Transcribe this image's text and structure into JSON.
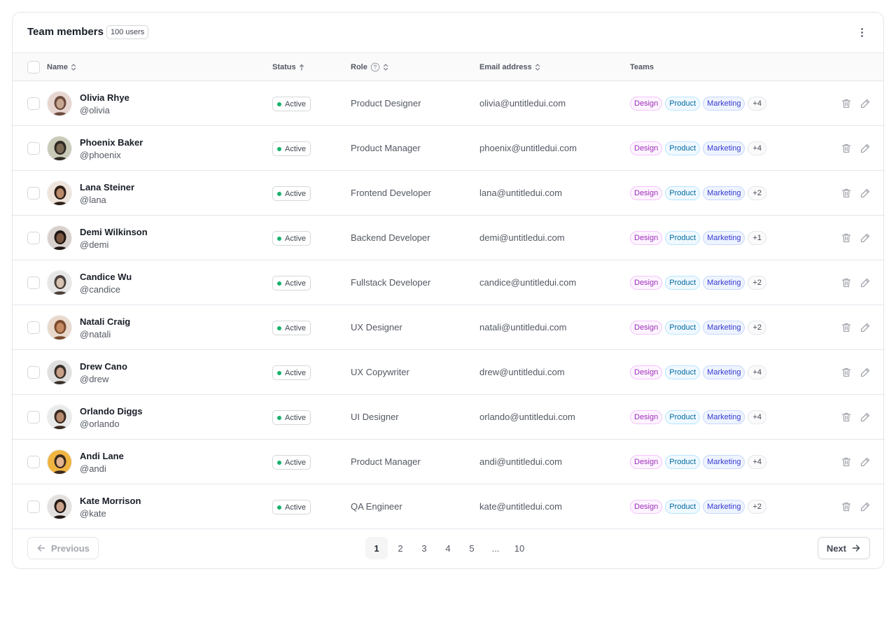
{
  "header": {
    "title": "Team members",
    "count_badge": "100 users"
  },
  "columns": {
    "name": "Name",
    "status": "Status",
    "role": "Role",
    "email": "Email address",
    "teams": "Teams"
  },
  "colors": {
    "design": "#9e2fb8",
    "product": "#026aa2",
    "marketing": "#3538cd",
    "active": "#17b26a"
  },
  "rows": [
    {
      "name": "Olivia Rhye",
      "handle": "@olivia",
      "status": "Active",
      "role": "Product Designer",
      "email": "olivia@untitledui.com",
      "teams": [
        "Design",
        "Product",
        "Marketing"
      ],
      "more": "+4"
    },
    {
      "name": "Phoenix Baker",
      "handle": "@phoenix",
      "status": "Active",
      "role": "Product Manager",
      "email": "phoenix@untitledui.com",
      "teams": [
        "Design",
        "Product",
        "Marketing"
      ],
      "more": "+4"
    },
    {
      "name": "Lana Steiner",
      "handle": "@lana",
      "status": "Active",
      "role": "Frontend Developer",
      "email": "lana@untitledui.com",
      "teams": [
        "Design",
        "Product",
        "Marketing"
      ],
      "more": "+2"
    },
    {
      "name": "Demi Wilkinson",
      "handle": "@demi",
      "status": "Active",
      "role": "Backend Developer",
      "email": "demi@untitledui.com",
      "teams": [
        "Design",
        "Product",
        "Marketing"
      ],
      "more": "+1"
    },
    {
      "name": "Candice Wu",
      "handle": "@candice",
      "status": "Active",
      "role": "Fullstack Developer",
      "email": "candice@untitledui.com",
      "teams": [
        "Design",
        "Product",
        "Marketing"
      ],
      "more": "+2"
    },
    {
      "name": "Natali Craig",
      "handle": "@natali",
      "status": "Active",
      "role": "UX Designer",
      "email": "natali@untitledui.com",
      "teams": [
        "Design",
        "Product",
        "Marketing"
      ],
      "more": "+2"
    },
    {
      "name": "Drew Cano",
      "handle": "@drew",
      "status": "Active",
      "role": "UX Copywriter",
      "email": "drew@untitledui.com",
      "teams": [
        "Design",
        "Product",
        "Marketing"
      ],
      "more": "+4"
    },
    {
      "name": "Orlando Diggs",
      "handle": "@orlando",
      "status": "Active",
      "role": "UI Designer",
      "email": "orlando@untitledui.com",
      "teams": [
        "Design",
        "Product",
        "Marketing"
      ],
      "more": "+4"
    },
    {
      "name": "Andi Lane",
      "handle": "@andi",
      "status": "Active",
      "role": "Product Manager",
      "email": "andi@untitledui.com",
      "teams": [
        "Design",
        "Product",
        "Marketing"
      ],
      "more": "+4"
    },
    {
      "name": "Kate Morrison",
      "handle": "@kate",
      "status": "Active",
      "role": "QA Engineer",
      "email": "kate@untitledui.com",
      "teams": [
        "Design",
        "Product",
        "Marketing"
      ],
      "more": "+2"
    }
  ],
  "pagination": {
    "previous": "Previous",
    "next": "Next",
    "pages": [
      "1",
      "2",
      "3",
      "4",
      "5",
      "...",
      "10"
    ],
    "current": "1"
  }
}
